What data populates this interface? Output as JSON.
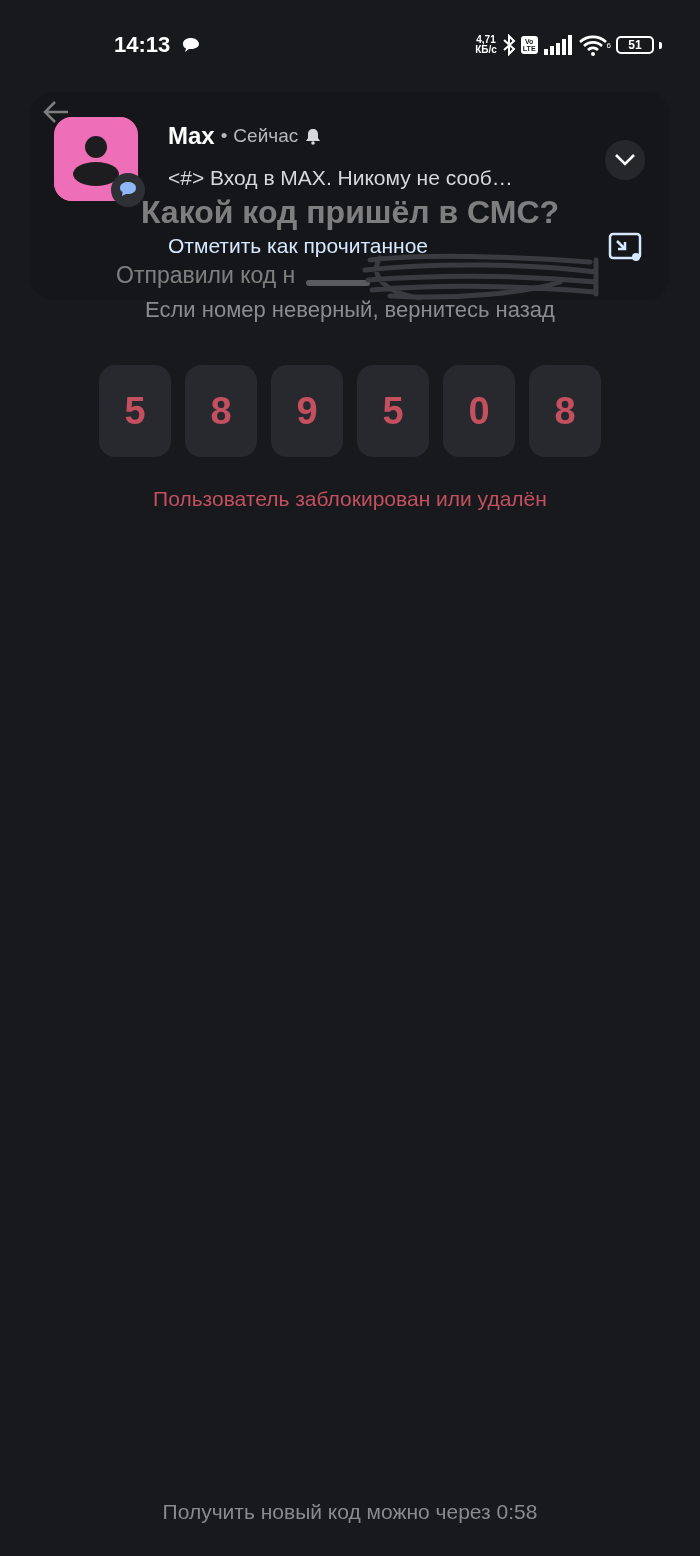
{
  "status_bar": {
    "time": "14:13",
    "net_speed": "4,71",
    "net_unit": "КБ/с",
    "volte_top": "Vo",
    "volte_bottom": "LTE",
    "wifi_label": "6",
    "battery": "51"
  },
  "screen": {
    "title": "Какой код пришёл в СМС?",
    "subtitle": "Отправили код н",
    "hint": "Если номер неверный, вернитесь назад",
    "code": [
      "5",
      "8",
      "9",
      "5",
      "0",
      "8"
    ],
    "error": "Пользователь заблокирован или удалён",
    "resend": "Получить новый код можно через 0:58"
  },
  "notification": {
    "app": "Max",
    "separator": "•",
    "time": "Сейчас",
    "message": "<#> Вход в MAX. Никому не сооб…",
    "action": "Отметить как прочитанное"
  }
}
